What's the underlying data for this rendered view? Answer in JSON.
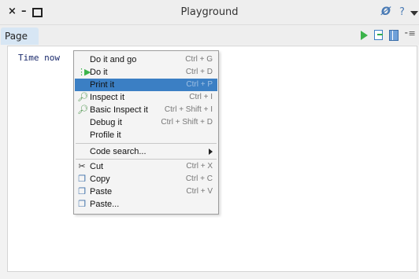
{
  "window": {
    "title": "Playground",
    "controls": {
      "close": "×",
      "minimize": "–"
    },
    "title_icons": {
      "pin": "Ø",
      "help": "?"
    }
  },
  "tabs": [
    {
      "label": "Page"
    }
  ],
  "toolbar": {
    "more": "⁃≡"
  },
  "editor": {
    "code": "Time now"
  },
  "context_menu": {
    "items": [
      {
        "label": "Do it and go",
        "shortcut": "Ctrl + G",
        "icon": ""
      },
      {
        "label": "Do it",
        "shortcut": "Ctrl + D",
        "icon": "doit-icon"
      },
      {
        "label": "Print it",
        "shortcut": "Ctrl + P",
        "icon": "",
        "selected": true
      },
      {
        "label": "Inspect it",
        "shortcut": "Ctrl + I",
        "icon": "inspect-icon"
      },
      {
        "label": "Basic Inspect it",
        "shortcut": "Ctrl + Shift + I",
        "icon": "inspect-icon"
      },
      {
        "label": "Debug it",
        "shortcut": "Ctrl + Shift + D",
        "icon": ""
      },
      {
        "label": "Profile it",
        "shortcut": "",
        "icon": ""
      },
      {
        "label": "Code search...",
        "shortcut": "",
        "icon": "",
        "submenu": true
      },
      {
        "label": "Cut",
        "shortcut": "Ctrl + X",
        "icon": "cut-icon"
      },
      {
        "label": "Copy",
        "shortcut": "Ctrl + C",
        "icon": "copy-icon"
      },
      {
        "label": "Paste",
        "shortcut": "Ctrl + V",
        "icon": "paste-icon"
      },
      {
        "label": "Paste...",
        "shortcut": "",
        "icon": "paste-icon"
      }
    ]
  },
  "colors": {
    "selection": "#3b7fc4",
    "tab": "#d7e6f4",
    "accent": "#4a7bb5"
  }
}
